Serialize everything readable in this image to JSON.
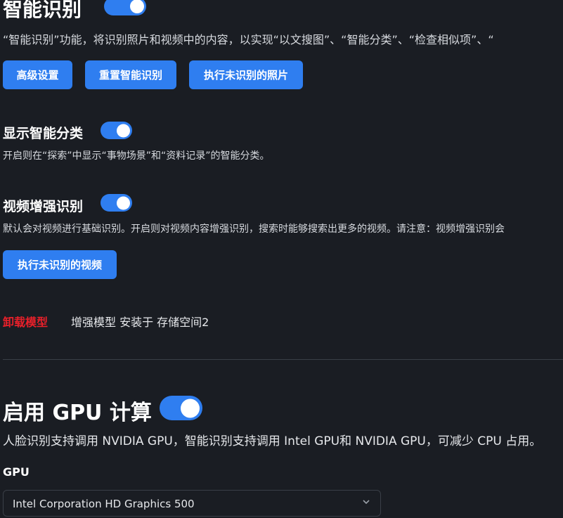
{
  "smart_recognition": {
    "title": "智能识别",
    "enabled": true,
    "description": "“智能识别”功能，将识别照片和视频中的内容，以实现“以文搜图”、“智能分类”、“检查相似项”、“",
    "buttons": {
      "advanced": "高级设置",
      "reset": "重置智能识别",
      "run_unrecognized_photos": "执行未识别的照片"
    }
  },
  "show_smart_categories": {
    "title": "显示智能分类",
    "enabled": true,
    "description": "开启则在“探索”中显示“事物场景”和“资料记录”的智能分类。"
  },
  "video_enhanced": {
    "title": "视频增强识别",
    "enabled": true,
    "description": "默认会对视频进行基础识别。开启则对视频内容增强识别，搜索时能够搜索出更多的视频。请注意：视频增强识别会",
    "button": "执行未识别的视频"
  },
  "model": {
    "uninstall_label": "卸载模型",
    "uninstall_color": "#e8202a",
    "status": "增强模型 安装于 存储空间2"
  },
  "gpu": {
    "title": "启用 GPU 计算",
    "enabled": true,
    "description": "人脸识别支持调用 NVIDIA GPU，智能识别支持调用 Intel GPU和 NVIDIA GPU，可减少 CPU 占用。",
    "select_label": "GPU",
    "selected": "Intel Corporation HD Graphics 500"
  },
  "colors": {
    "accent": "#2f7ef0",
    "background": "#1a1d23"
  }
}
